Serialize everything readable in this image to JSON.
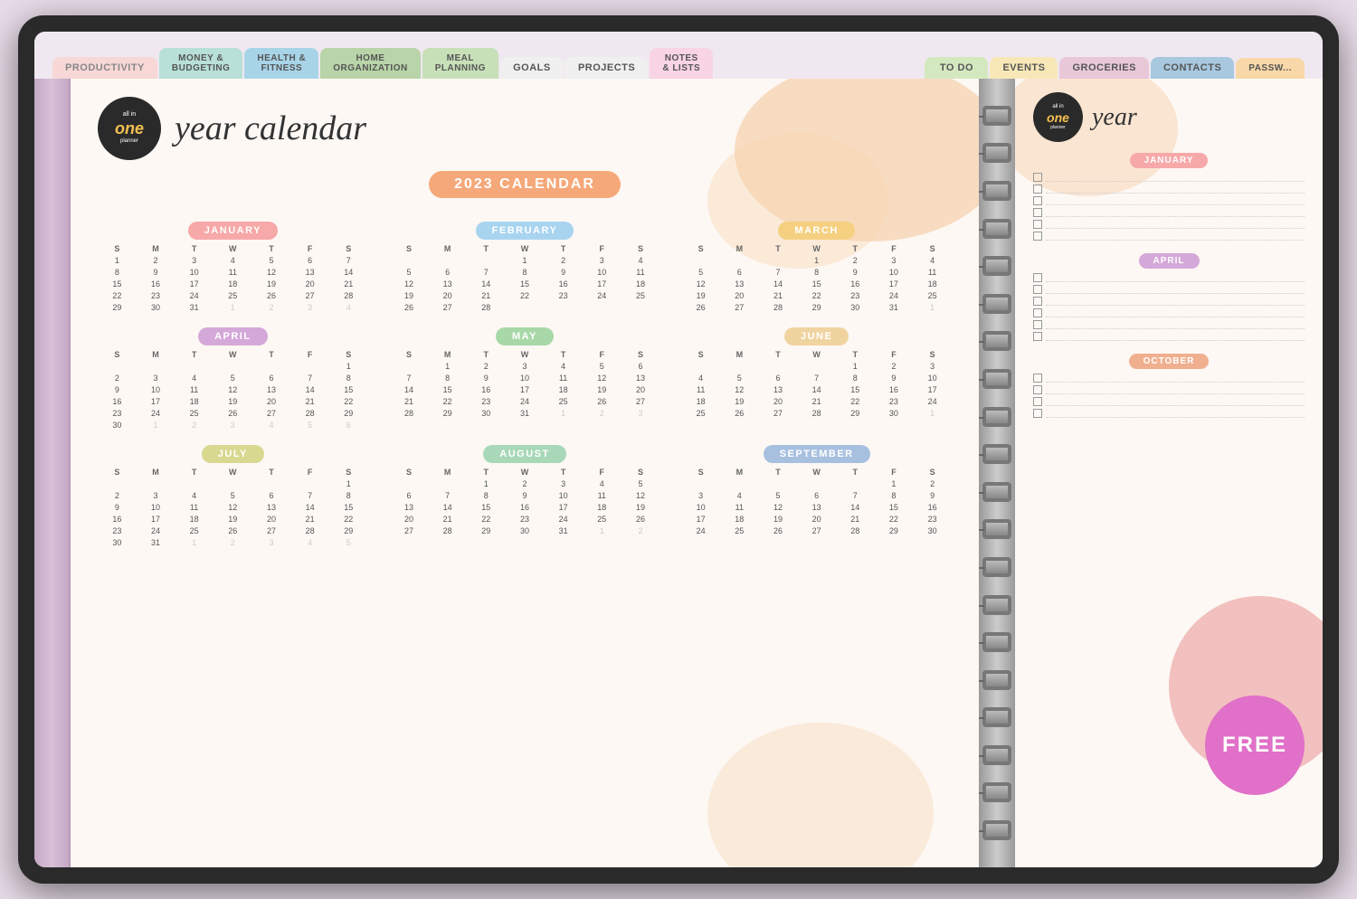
{
  "tabs": {
    "items": [
      {
        "label": "PRODUCTIVITY",
        "class": "tab-productivity"
      },
      {
        "label": "MONEY &\nBUDGETING",
        "class": "tab-money"
      },
      {
        "label": "HEALTH &\nFITNESS",
        "class": "tab-health"
      },
      {
        "label": "HOME\nORGANIZATION",
        "class": "tab-home"
      },
      {
        "label": "MEAL\nPLANNING",
        "class": "tab-meal"
      },
      {
        "label": "GOALS",
        "class": "tab-goals"
      },
      {
        "label": "PROJECTS",
        "class": "tab-projects"
      },
      {
        "label": "NOTES\n& LISTS",
        "class": "tab-notes"
      },
      {
        "label": "TO DO",
        "class": "tab-todo"
      },
      {
        "label": "EVENTS",
        "class": "tab-events"
      },
      {
        "label": "GROCERIES",
        "class": "tab-groceries"
      },
      {
        "label": "CONTACTS",
        "class": "tab-contacts"
      },
      {
        "label": "PASSW...",
        "class": "tab-password"
      }
    ]
  },
  "logo": {
    "line1": "all in",
    "line2": "one",
    "line3": "planner"
  },
  "title": "year calendar",
  "calendar_badge": "2023 CALENDAR",
  "months": [
    {
      "name": "JANUARY",
      "color_class": "jan-color",
      "days_header": [
        "S",
        "M",
        "T",
        "W",
        "T",
        "F",
        "S"
      ],
      "weeks": [
        [
          "1",
          "2",
          "3",
          "4",
          "5",
          "6",
          "7"
        ],
        [
          "8",
          "9",
          "10",
          "11",
          "12",
          "13",
          "14"
        ],
        [
          "15",
          "16",
          "17",
          "18",
          "19",
          "20",
          "21"
        ],
        [
          "22",
          "23",
          "24",
          "25",
          "26",
          "27",
          "28"
        ],
        [
          "29",
          "30",
          "31",
          "1",
          "2",
          "3",
          "4"
        ]
      ],
      "other_month_cells": [
        "1",
        "2",
        "3",
        "4"
      ]
    },
    {
      "name": "FEBRUARY",
      "color_class": "feb-color",
      "days_header": [
        "S",
        "M",
        "T",
        "W",
        "T",
        "F",
        "S"
      ],
      "weeks": [
        [
          "",
          "",
          "",
          "1",
          "2",
          "3",
          "4"
        ],
        [
          "5",
          "6",
          "7",
          "8",
          "9",
          "10",
          "11"
        ],
        [
          "12",
          "13",
          "14",
          "15",
          "16",
          "17",
          "18"
        ],
        [
          "19",
          "20",
          "21",
          "22",
          "23",
          "24",
          "25"
        ],
        [
          "26",
          "27",
          "28",
          "",
          "",
          "",
          ""
        ]
      ]
    },
    {
      "name": "MARCH",
      "color_class": "mar-color",
      "days_header": [
        "S",
        "M",
        "T",
        "W",
        "T",
        "F",
        "S"
      ],
      "weeks": [
        [
          "",
          "",
          "",
          "1",
          "2",
          "3",
          "4"
        ],
        [
          "5",
          "6",
          "7",
          "8",
          "9",
          "10",
          "11"
        ],
        [
          "12",
          "13",
          "14",
          "15",
          "16",
          "17",
          "18"
        ],
        [
          "19",
          "20",
          "21",
          "22",
          "23",
          "24",
          "25"
        ],
        [
          "26",
          "27",
          "28",
          "29",
          "30",
          "31",
          "1"
        ]
      ]
    },
    {
      "name": "APRIL",
      "color_class": "apr-color",
      "days_header": [
        "S",
        "M",
        "T",
        "W",
        "T",
        "F",
        "S"
      ],
      "weeks": [
        [
          "",
          "",
          "",
          "",
          "",
          "",
          "1"
        ],
        [
          "2",
          "3",
          "4",
          "5",
          "6",
          "7",
          "8"
        ],
        [
          "9",
          "10",
          "11",
          "12",
          "13",
          "14",
          "15"
        ],
        [
          "16",
          "17",
          "18",
          "19",
          "20",
          "21",
          "22"
        ],
        [
          "23",
          "24",
          "25",
          "26",
          "27",
          "28",
          "29"
        ],
        [
          "30",
          "1",
          "2",
          "3",
          "4",
          "5",
          "6"
        ]
      ]
    },
    {
      "name": "MAY",
      "color_class": "may-color",
      "days_header": [
        "S",
        "M",
        "T",
        "W",
        "T",
        "F",
        "S"
      ],
      "weeks": [
        [
          "",
          "1",
          "2",
          "3",
          "4",
          "5",
          "6"
        ],
        [
          "7",
          "8",
          "9",
          "10",
          "11",
          "12",
          "13"
        ],
        [
          "14",
          "15",
          "16",
          "17",
          "18",
          "19",
          "20"
        ],
        [
          "21",
          "22",
          "23",
          "24",
          "25",
          "26",
          "27"
        ],
        [
          "28",
          "29",
          "30",
          "31",
          "1",
          "2",
          "3"
        ]
      ]
    },
    {
      "name": "JUNE",
      "color_class": "jun-color",
      "days_header": [
        "S",
        "M",
        "T",
        "W",
        "T",
        "F",
        "S"
      ],
      "weeks": [
        [
          "",
          "",
          "",
          "",
          "1",
          "2",
          "3"
        ],
        [
          "4",
          "5",
          "6",
          "7",
          "8",
          "9",
          "10"
        ],
        [
          "11",
          "12",
          "13",
          "14",
          "15",
          "16",
          "17"
        ],
        [
          "18",
          "19",
          "20",
          "21",
          "22",
          "23",
          "24"
        ],
        [
          "25",
          "26",
          "27",
          "28",
          "29",
          "30",
          "1"
        ]
      ]
    },
    {
      "name": "JULY",
      "color_class": "jul-color",
      "days_header": [
        "S",
        "M",
        "T",
        "W",
        "T",
        "F",
        "S"
      ],
      "weeks": [
        [
          "",
          "",
          "",
          "",
          "",
          "",
          "1"
        ],
        [
          "2",
          "3",
          "4",
          "5",
          "6",
          "7",
          "8"
        ],
        [
          "9",
          "10",
          "11",
          "12",
          "13",
          "14",
          "15"
        ],
        [
          "16",
          "17",
          "18",
          "19",
          "20",
          "21",
          "22"
        ],
        [
          "23",
          "24",
          "25",
          "26",
          "27",
          "28",
          "29"
        ],
        [
          "30",
          "31",
          "1",
          "2",
          "3",
          "4",
          "5"
        ]
      ]
    },
    {
      "name": "AUGUST",
      "color_class": "aug-color",
      "days_header": [
        "S",
        "M",
        "T",
        "W",
        "T",
        "F",
        "S"
      ],
      "weeks": [
        [
          "",
          "",
          "1",
          "2",
          "3",
          "4",
          "5"
        ],
        [
          "6",
          "7",
          "8",
          "9",
          "10",
          "11",
          "12"
        ],
        [
          "13",
          "14",
          "15",
          "16",
          "17",
          "18",
          "19"
        ],
        [
          "20",
          "21",
          "22",
          "23",
          "24",
          "25",
          "26"
        ],
        [
          "27",
          "28",
          "29",
          "30",
          "31",
          "1",
          "2"
        ]
      ]
    },
    {
      "name": "SEPTEMBER",
      "color_class": "sep-color",
      "days_header": [
        "S",
        "M",
        "T",
        "W",
        "T",
        "F",
        "S"
      ],
      "weeks": [
        [
          "",
          "",
          "",
          "",
          "",
          "1",
          "2"
        ],
        [
          "3",
          "4",
          "5",
          "6",
          "7",
          "8",
          "9"
        ],
        [
          "10",
          "11",
          "12",
          "13",
          "14",
          "15",
          "16"
        ],
        [
          "17",
          "18",
          "19",
          "20",
          "21",
          "22",
          "23"
        ],
        [
          "24",
          "25",
          "26",
          "27",
          "28",
          "29",
          "30"
        ]
      ]
    }
  ],
  "right_panel": {
    "title": "year",
    "checklist_months": [
      {
        "name": "JANUARY",
        "color_class": "jan-color",
        "rows": 6
      },
      {
        "name": "APRIL",
        "color_class": "apr-color",
        "rows": 6
      }
    ]
  },
  "free_badge": "FREE"
}
